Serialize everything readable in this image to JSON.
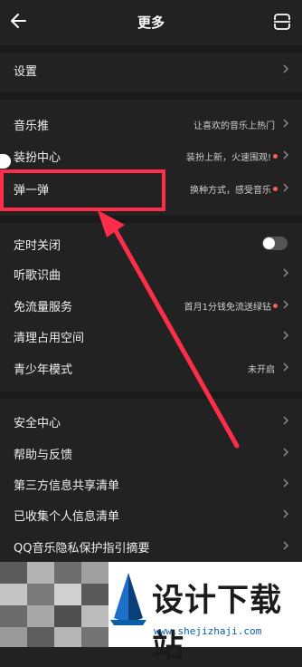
{
  "header": {
    "title": "更多"
  },
  "sections": [
    {
      "items": [
        {
          "label": "设置"
        }
      ]
    },
    {
      "items": [
        {
          "label": "音乐推",
          "value": "让喜欢的音乐上热门"
        },
        {
          "label": "装扮中心",
          "value": "装扮上新，火速围观!",
          "dot": true
        },
        {
          "label": "弹一弹",
          "value": "换种方式，感受音乐",
          "dot": true
        }
      ]
    },
    {
      "items": [
        {
          "label": "定时关闭",
          "toggle": "off"
        },
        {
          "label": "听歌识曲"
        },
        {
          "label": "免流量服务",
          "value": "首月1分钱免流送绿钻",
          "dot": true
        },
        {
          "label": "清理占用空间"
        },
        {
          "label": "青少年模式",
          "value": "未开启"
        }
      ]
    },
    {
      "items": [
        {
          "label": "安全中心"
        },
        {
          "label": "帮助与反馈"
        },
        {
          "label": "第三方信息共享清单"
        },
        {
          "label": "已收集个人信息清单"
        },
        {
          "label": "QQ音乐隐私保护指引摘要"
        }
      ]
    }
  ],
  "watermark": {
    "title": "设计下载站",
    "url": "www.shejizhaji.com"
  },
  "colors": {
    "background": "#222222",
    "divider": "#1a1a1a",
    "dot": "#ff5b5b",
    "highlight": "#ff2d49"
  }
}
